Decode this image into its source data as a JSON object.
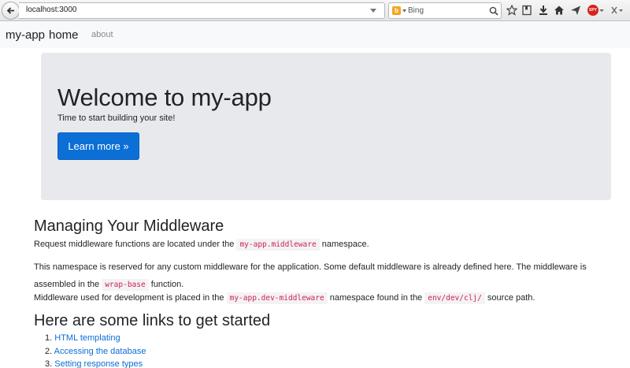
{
  "browser": {
    "url": "localhost:3000",
    "search_engine": "Bing",
    "bing_logo_letter": "b",
    "addon_badge": "SPY"
  },
  "navbar": {
    "brand": "my-app",
    "home": "home",
    "about": "about"
  },
  "jumbotron": {
    "title": "Welcome to my-app",
    "lead": "Time to start building your site!",
    "button_label": "Learn more »"
  },
  "middleware": {
    "heading": "Managing Your Middleware",
    "p1_before": "Request middleware functions are located under the ",
    "p1_code": "my-app.middleware",
    "p1_after": " namespace.",
    "p2_before": "This namespace is reserved for any custom middleware for the application. Some default middleware is already defined here. The middleware is assembled in the ",
    "p2_code": "wrap-base",
    "p2_after": " function.",
    "p3_before": "Middleware used for development is placed in the ",
    "p3_code1": "my-app.dev-middleware",
    "p3_middle": " namespace found in the ",
    "p3_code2": "env/dev/clj/",
    "p3_after": " source path."
  },
  "links": {
    "heading": "Here are some links to get started",
    "items": [
      {
        "num": "1.",
        "label": "HTML templating"
      },
      {
        "num": "2.",
        "label": "Accessing the database"
      },
      {
        "num": "3.",
        "label": "Setting response types"
      }
    ]
  }
}
